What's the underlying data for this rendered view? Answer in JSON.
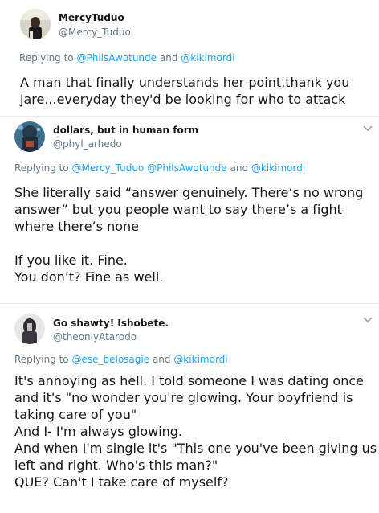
{
  "tweets": [
    {
      "name": "MercyTuduo",
      "handle": "@Mercy_Tuduo",
      "reply_prefix": "Replying to",
      "mentions": [
        "@PhilsAwotunde",
        "@kikimordi"
      ],
      "mention_join": "and",
      "lines": [
        "A man that finally understands her point,thank you",
        "jare...everyday they'd be looking for who to attack"
      ]
    },
    {
      "name": "dollars, but in human form",
      "handle": "@phyl_arhedo",
      "reply_prefix": "Replying to",
      "mentions": [
        "@Mercy_Tuduo",
        "@PhilsAwotunde",
        "@kikimordi"
      ],
      "mention_join": "and",
      "lines": [
        "She literally said “answer genuinely. There’s no wrong",
        "answer” but you people want to say there’s a fight",
        "where there’s none",
        "",
        "If you like it. Fine.",
        "You don’t? Fine as well."
      ]
    },
    {
      "name": "Go shawty! Ishobete.",
      "handle": "@theonlyAtarodo",
      "reply_prefix": "Replying to",
      "mentions": [
        "@ese_belosagie",
        "@kikimordi"
      ],
      "mention_join": "and",
      "lines": [
        "It's annoying as hell. I told someone I was dating once",
        "and it's \"no wonder you're glowing. Your boyfriend is",
        "taking care of you\"",
        "And I- I'm always glowing.",
        "And when I'm single it's \"This one you've been giving us",
        "left and right. Who's this man?\"",
        "QUE? Can't I take care of myself?"
      ]
    }
  ],
  "icons": {
    "menu": "chevron-down-icon"
  },
  "colors": {
    "text": "#14171a",
    "muted": "#657786",
    "link": "#1da1f2",
    "divider": "#e6ecf0"
  }
}
